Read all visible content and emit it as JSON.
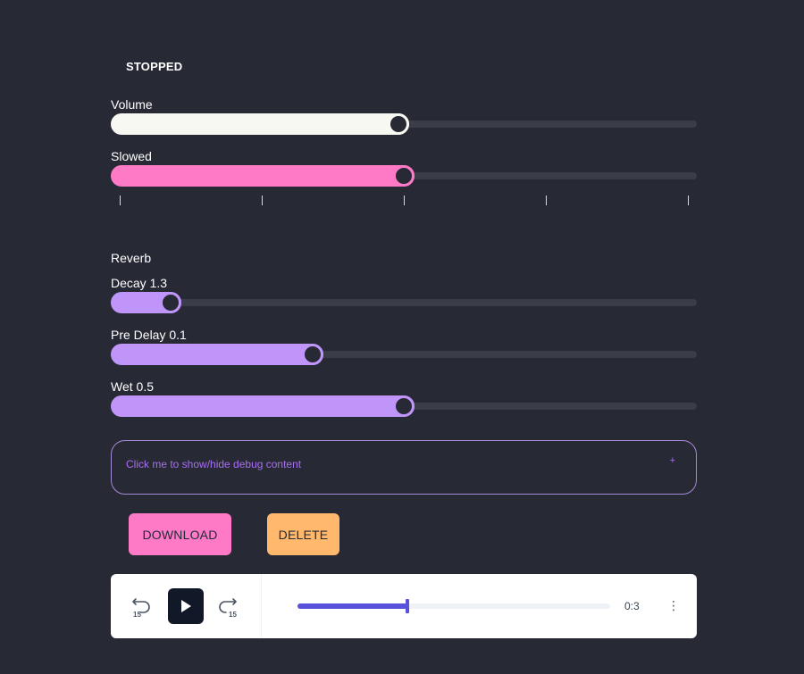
{
  "status": "STOPPED",
  "sliders": {
    "volume": {
      "label": "Volume",
      "value": 0.49,
      "color": "#f8f8f2"
    },
    "slowed": {
      "label": "Slowed",
      "value": 0.5,
      "color": "#ff7ac6",
      "tick_count": 5
    },
    "decay": {
      "label": "Decay 1.3",
      "value": 0.09,
      "color": "#bf95f9"
    },
    "pre_delay": {
      "label": "Pre Delay 0.1",
      "value": 0.34,
      "color": "#bf95f9"
    },
    "wet": {
      "label": "Wet 0.5",
      "value": 0.5,
      "color": "#bf95f9"
    }
  },
  "reverb_heading": "Reverb",
  "debug": {
    "label": "Click me to show/hide debug content",
    "toggle_symbol": "+"
  },
  "buttons": {
    "download": "DOWNLOAD",
    "delete": "DELETE"
  },
  "player": {
    "rewind_icon": "rewind-15-icon",
    "play_icon": "play-icon",
    "forward_icon": "forward-15-icon",
    "more_icon": "more-vertical-icon",
    "skip_seconds": "15",
    "progress": 0.35,
    "time": "0:3"
  },
  "colors": {
    "background": "#272935",
    "accent_purple": "#a770ef",
    "seek": "#5851db"
  }
}
